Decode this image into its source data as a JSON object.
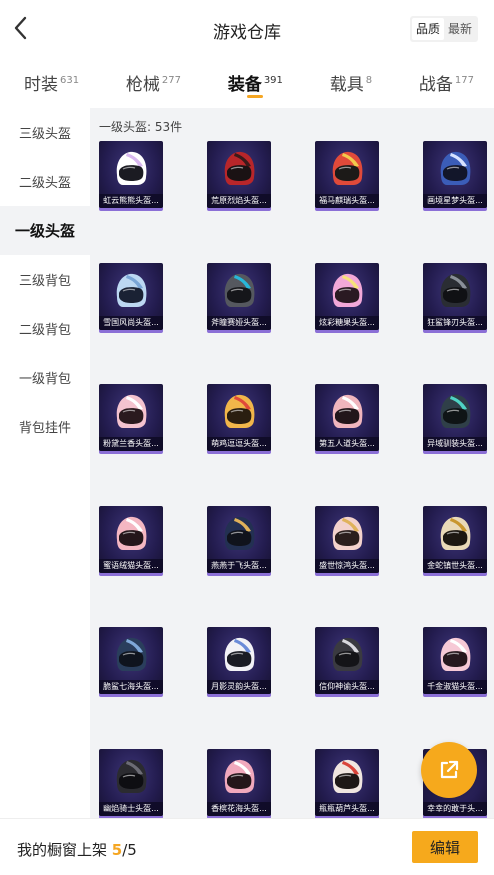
{
  "header": {
    "title": "游戏仓库",
    "sort_options": [
      "品质",
      "最新"
    ],
    "sort_selected": "品质"
  },
  "tabs": [
    {
      "label": "时装",
      "count": "631",
      "active": false
    },
    {
      "label": "枪械",
      "count": "277",
      "active": false
    },
    {
      "label": "装备",
      "count": "391",
      "active": true
    },
    {
      "label": "载具",
      "count": "8",
      "active": false
    },
    {
      "label": "战备",
      "count": "177",
      "active": false
    }
  ],
  "sidebar": {
    "items": [
      {
        "label": "三级头盔",
        "active": false
      },
      {
        "label": "二级头盔",
        "active": false
      },
      {
        "label": "一级头盔",
        "active": true
      },
      {
        "label": "三级背包",
        "active": false
      },
      {
        "label": "二级背包",
        "active": false
      },
      {
        "label": "一级背包",
        "active": false
      },
      {
        "label": "背包挂件",
        "active": false
      }
    ]
  },
  "content": {
    "section_title": "一级头盔: 53件",
    "items": [
      {
        "name": "虹云熊熊头盔...",
        "shell": "#ffffff",
        "accent": "#d9b8f0",
        "visor": "#1b1b22"
      },
      {
        "name": "荒原烈焰头盔...",
        "shell": "#b8262a",
        "accent": "#3a1a1a",
        "visor": "#1a1214"
      },
      {
        "name": "福马麒瑞头盔...",
        "shell": "#e04a3a",
        "accent": "#f2c94c",
        "visor": "#1c1a18"
      },
      {
        "name": "画境星梦头盔...",
        "shell": "#3b5db8",
        "accent": "#d6e2ff",
        "visor": "#12162a"
      },
      {
        "name": "雪国风尚头盔...",
        "shell": "#bcd8f2",
        "accent": "#7aa6d6",
        "visor": "#1a2234"
      },
      {
        "name": "斧瞳赛娅头盔...",
        "shell": "#55585f",
        "accent": "#28b7d9",
        "visor": "#15161a"
      },
      {
        "name": "炫彩糖果头盔...",
        "shell": "#f2a8d8",
        "accent": "#f6e27a",
        "visor": "#2a1a22"
      },
      {
        "name": "狂鲨锋刃头盔...",
        "shell": "#2a2d33",
        "accent": "#8a9098",
        "visor": "#101114"
      },
      {
        "name": "粉黛兰香头盔...",
        "shell": "#f4c3cf",
        "accent": "#ffffff",
        "visor": "#2a1a1e"
      },
      {
        "name": "萌鸡逗逗头盔...",
        "shell": "#f1b64a",
        "accent": "#e04a3a",
        "visor": "#2a1e10"
      },
      {
        "name": "第五人道头盔...",
        "shell": "#f0b6bd",
        "accent": "#ffffff",
        "visor": "#22161a"
      },
      {
        "name": "异域驯装头盔...",
        "shell": "#2f3f48",
        "accent": "#4fd3c4",
        "visor": "#0f1416"
      },
      {
        "name": "蜜语绒猫头盔...",
        "shell": "#f4b7c2",
        "accent": "#ffffff",
        "visor": "#24161a"
      },
      {
        "name": "燕燕于飞头盔...",
        "shell": "#233052",
        "accent": "#e0b25a",
        "visor": "#10131c"
      },
      {
        "name": "盛世惊鸿头盔...",
        "shell": "#f3d2cc",
        "accent": "#e0b25a",
        "visor": "#2a1e1c"
      },
      {
        "name": "金蛇镇世头盔...",
        "shell": "#e9d9b8",
        "accent": "#c8962f",
        "visor": "#1c1712"
      },
      {
        "name": "脆鲨七海头盔...",
        "shell": "#2a3e5c",
        "accent": "#7fa8d8",
        "visor": "#0f141e"
      },
      {
        "name": "月影灵韵头盔...",
        "shell": "#f2f2f6",
        "accent": "#6a8bd8",
        "visor": "#1a1c24"
      },
      {
        "name": "信仰神谕头盔...",
        "shell": "#3a3a40",
        "accent": "#d9d9de",
        "visor": "#141418"
      },
      {
        "name": "千金淑猫头盔...",
        "shell": "#f6c9d6",
        "accent": "#ffffff",
        "visor": "#26181e"
      },
      {
        "name": "幽焰骑士头盔...",
        "shell": "#2b2b30",
        "accent": "#6c6c75",
        "visor": "#0e0e12"
      },
      {
        "name": "香槟花海头盔...",
        "shell": "#f1a9bd",
        "accent": "#ffffff",
        "visor": "#24161a"
      },
      {
        "name": "瓶瓶葫芦头盔...",
        "shell": "#f0e6e0",
        "accent": "#d9443a",
        "visor": "#1e1816"
      },
      {
        "name": "幸幸的敢于头...",
        "shell": "#d9c9a8",
        "accent": "#8c6a3a",
        "visor": "#1a1612"
      }
    ]
  },
  "bottom_bar": {
    "shelf_label": "我的橱窗上架 ",
    "shelf_current": "5",
    "shelf_sep": "/",
    "shelf_total": "5",
    "edit_label": "编辑"
  },
  "colors": {
    "accent": "#f6a91c",
    "card_bg": "#231c4f",
    "card_border": "#8b6fd6",
    "content_bg": "#f2f3f5"
  },
  "icons": {
    "back": "chevron-left-icon",
    "share": "share-external-icon"
  }
}
